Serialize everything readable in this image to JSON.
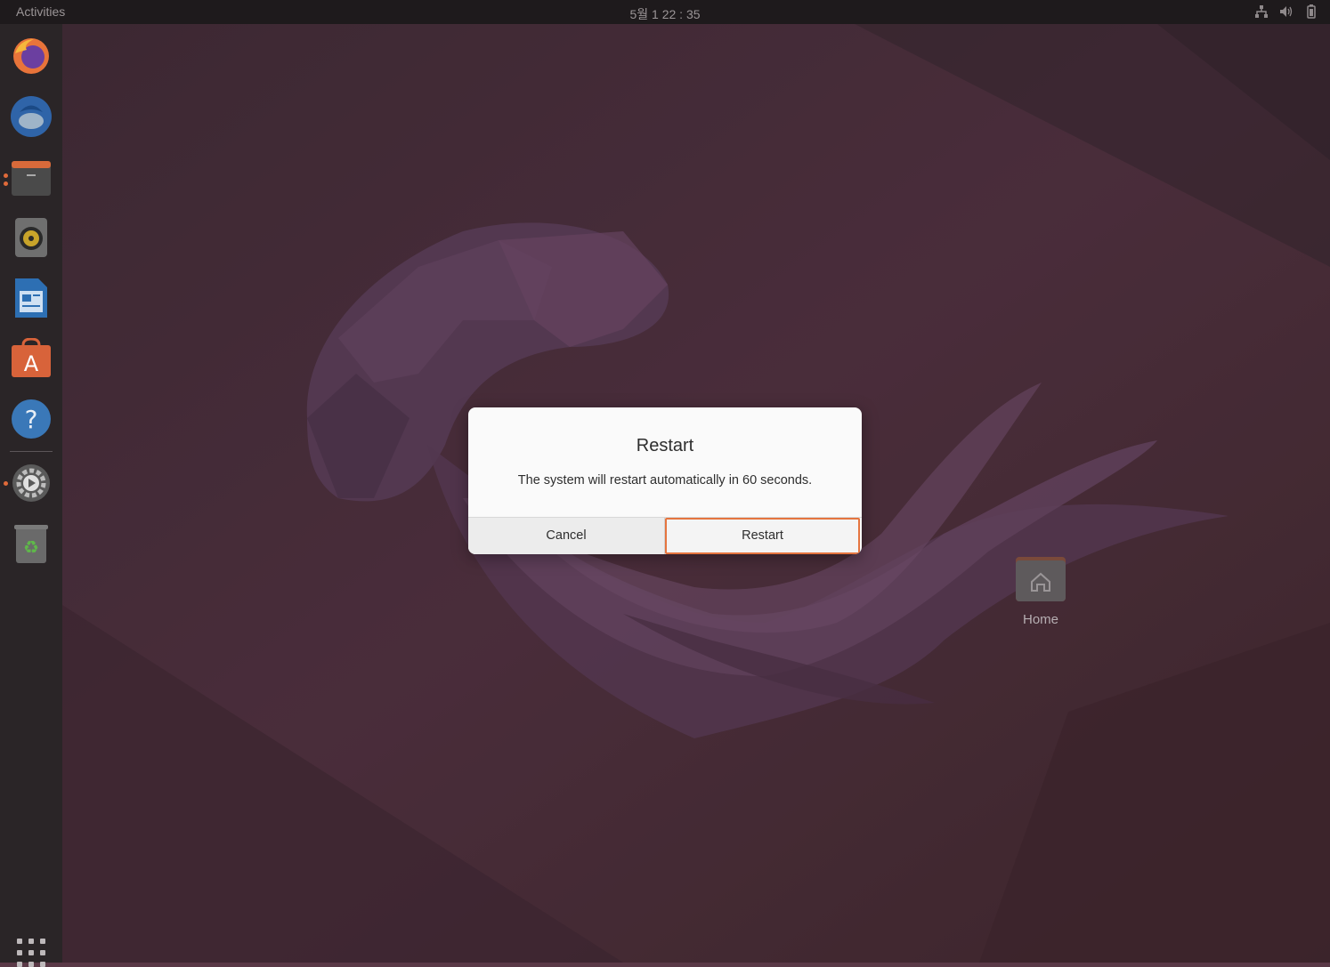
{
  "topbar": {
    "activities": "Activities",
    "clock": "5월 1  22 : 35",
    "tray_icons": [
      "network-icon",
      "volume-icon",
      "battery-icon"
    ]
  },
  "dock": {
    "items": [
      {
        "name": "firefox",
        "icon": "firefox-icon"
      },
      {
        "name": "thunderbird",
        "icon": "thunderbird-icon"
      },
      {
        "name": "files",
        "icon": "files-icon",
        "running": true
      },
      {
        "name": "rhythmbox",
        "icon": "rhythmbox-icon"
      },
      {
        "name": "libreoffice-writer",
        "icon": "writer-icon"
      },
      {
        "name": "ubuntu-software",
        "icon": "software-icon"
      },
      {
        "name": "help",
        "icon": "help-icon"
      },
      {
        "name": "settings",
        "icon": "settings-icon",
        "running": true
      },
      {
        "name": "trash",
        "icon": "trash-icon"
      }
    ],
    "show_apps_icon": "grid-icon"
  },
  "desktop": {
    "home_label": "Home"
  },
  "dialog": {
    "title": "Restart",
    "message": "The system will restart automatically in 60 seconds.",
    "cancel_label": "Cancel",
    "restart_label": "Restart"
  },
  "colors": {
    "accent": "#e5753f",
    "topbar": "#1e1a1c",
    "dock": "#2a2527",
    "wallpaper": "#5a3947"
  }
}
